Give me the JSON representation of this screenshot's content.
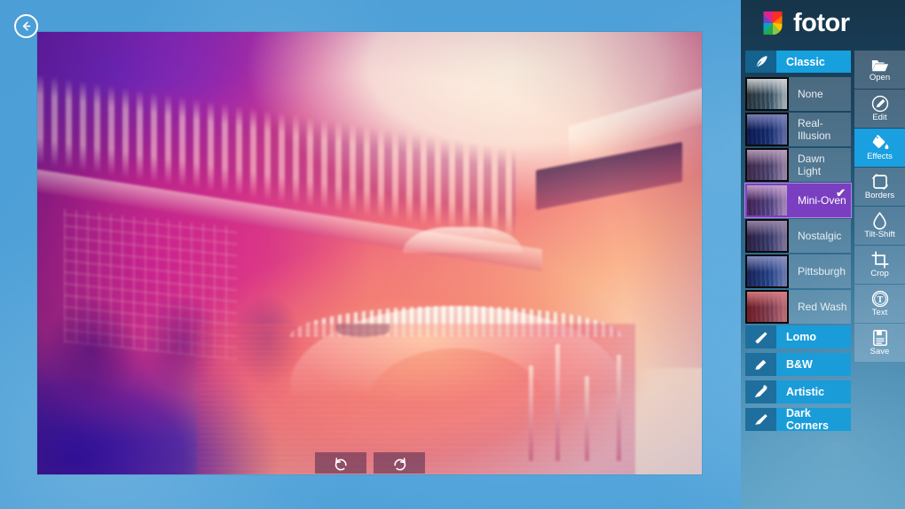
{
  "app": {
    "brand": "fotor"
  },
  "nav": {
    "back_label": "back-arrow"
  },
  "canvas": {
    "undo_label": "undo",
    "redo_label": "redo"
  },
  "effects_panel": {
    "category_header": {
      "label": "Classic",
      "icon": "feather-brush-icon"
    },
    "filters": [
      {
        "label": "None",
        "tint": "rgba(120,128,136,0.30)"
      },
      {
        "label": "Real-Illusion",
        "tint": "rgba(18,28,128,0.52)"
      },
      {
        "label": "Dawn Light",
        "tint": "rgba(120,60,120,0.48)"
      },
      {
        "label": "Mini-Oven",
        "tint": "rgba(135,45,150,0.42)",
        "selected": true
      },
      {
        "label": "Nostalgic",
        "tint": "rgba(70,35,95,0.52)"
      },
      {
        "label": "Pittsburgh",
        "tint": "rgba(30,40,140,0.50)"
      },
      {
        "label": "Red Wash",
        "tint": "rgba(185,25,35,0.55)"
      }
    ],
    "categories": [
      {
        "label": "Lomo",
        "icon": "flat-brush-icon"
      },
      {
        "label": "B&W",
        "icon": "pencil-icon"
      },
      {
        "label": "Artistic",
        "icon": "paintbrush-icon"
      },
      {
        "label": "Dark Corners",
        "icon": "brush-icon"
      }
    ],
    "selected_filter": "Mini-Oven",
    "selected_mark": "✔"
  },
  "toolbar": {
    "items": [
      {
        "label": "Open",
        "icon": "folder-icon"
      },
      {
        "label": "Edit",
        "icon": "pencil-circle-icon"
      },
      {
        "label": "Effects",
        "icon": "paint-bucket-icon",
        "active": true
      },
      {
        "label": "Borders",
        "icon": "frame-icon"
      },
      {
        "label": "Tilt-Shift",
        "icon": "droplet-icon"
      },
      {
        "label": "Crop",
        "icon": "crop-icon"
      },
      {
        "label": "Text",
        "icon": "text-circle-icon"
      },
      {
        "label": "Save",
        "icon": "floppy-disk-icon"
      }
    ]
  },
  "colors": {
    "accent_blue": "#1a9fe0",
    "selection_purple": "#7a3fc0",
    "panel_dark": "#163449",
    "desktop_blue": "#55a8de"
  }
}
